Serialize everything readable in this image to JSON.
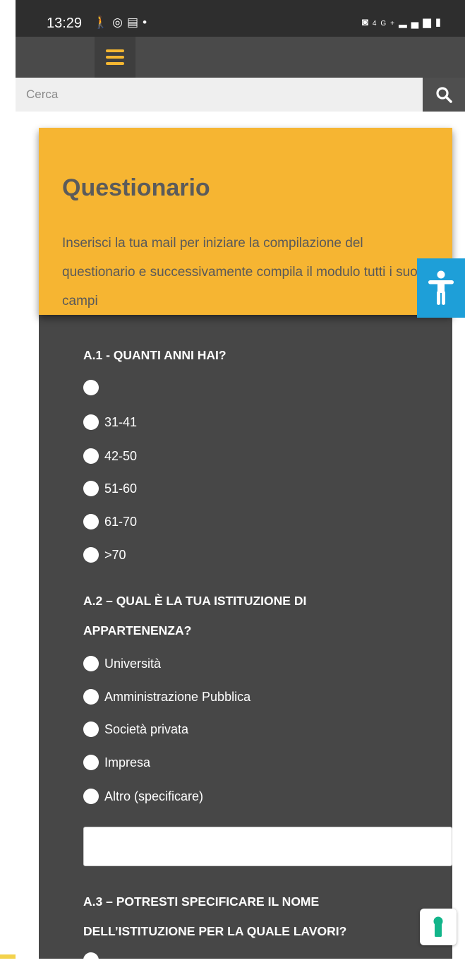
{
  "status_bar": {
    "time": "13:29",
    "left_icons": [
      "walk-icon",
      "app-icon",
      "calendar-icon",
      "dot-icon"
    ],
    "right_icons": [
      "battery-saver-icon",
      "4g-icon",
      "signal-icon",
      "battery-icon"
    ]
  },
  "search": {
    "placeholder": "Cerca"
  },
  "header_card": {
    "title": "Questionario",
    "description": "Inserisci la tua mail per iniziare la compilazione del questionario e successivamente compila il modulo tutti i suoi campi"
  },
  "questions": [
    {
      "label": "A.1 - QUANTI ANNI HAI?",
      "options": [
        "",
        "31-41",
        "42-50",
        "51-60",
        "61-70",
        ">70"
      ]
    },
    {
      "label": "A.2 – QUAL È LA TUA ISTITUZIONE DI APPARTENENZA?",
      "options": [
        "Università",
        "Amministrazione Pubblica",
        "Società privata",
        "Impresa",
        "Altro (specificare)"
      ]
    },
    {
      "label": "A.3 – POTRESTI SPECIFICARE IL NOME DELL’ISTITUZIONE PER LA QUALE LAVORI?"
    }
  ],
  "colors": {
    "accent": "#f6b532",
    "panel": "#474747",
    "accessibility": "#1e9fd8"
  }
}
